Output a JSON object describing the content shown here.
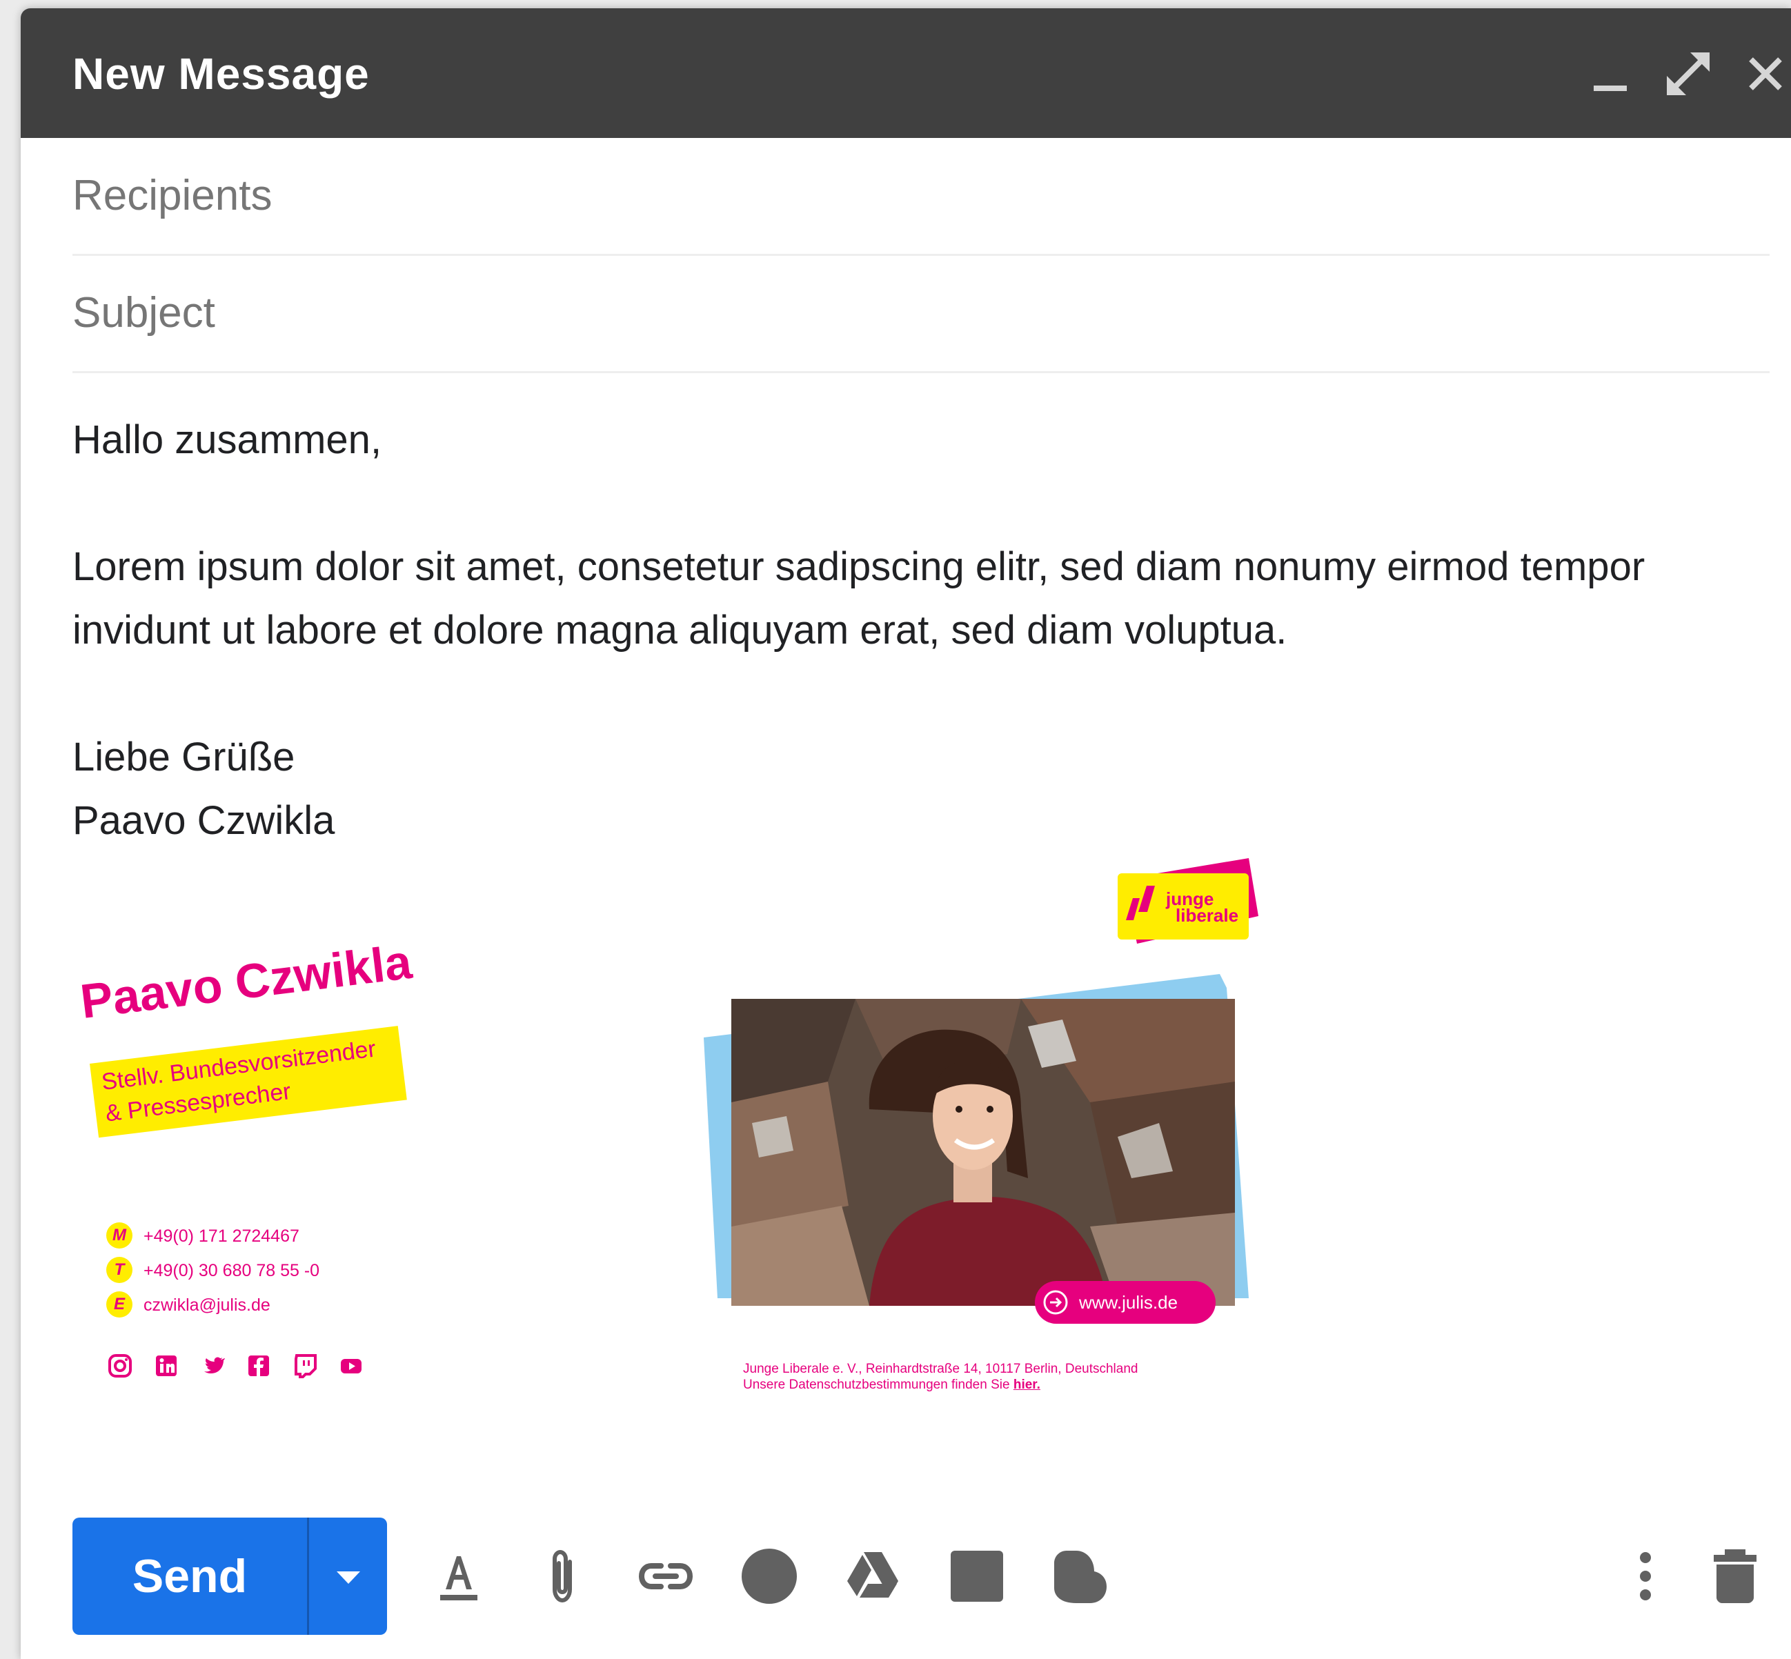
{
  "window": {
    "title": "New Message",
    "minimize_icon": "minimize-icon",
    "expand_icon": "expand-icon",
    "close_icon": "close-icon"
  },
  "fields": {
    "recipients_placeholder": "Recipients",
    "subject_placeholder": "Subject"
  },
  "body": {
    "greeting": "Hallo zusammen,",
    "paragraph_line1": "Lorem ipsum dolor sit amet, consetetur sadipscing elitr, sed diam nonumy eirmod tempor",
    "paragraph_line2": "invidunt ut labore et dolore magna aliquyam erat, sed diam voluptua.",
    "closing": "Liebe Grüße",
    "sender": "Paavo Czwikla"
  },
  "signature": {
    "name": "Paavo Czwikla",
    "role_line1": "Stellv. Bundesvorsitzender",
    "role_line2": "& Pressesprecher",
    "contacts": [
      {
        "badge": "M",
        "value": "+49(0) 171 2724467"
      },
      {
        "badge": "T",
        "value": "+49(0) 30 680 78 55 -0"
      },
      {
        "badge": "E",
        "value": "czwikla@julis.de"
      }
    ],
    "social_icons": [
      "instagram-icon",
      "linkedin-icon",
      "twitter-icon",
      "facebook-icon",
      "twitch-icon",
      "youtube-icon"
    ],
    "logo_line1": "junge",
    "logo_line2": "liberale",
    "website": "www.julis.de",
    "address": "Junge Liberale e. V., Reinhardtstraße 14, 10117 Berlin, Deutschland",
    "privacy_text": "Unsere Datenschutzbestimmungen finden Sie",
    "privacy_link": "hier.",
    "colors": {
      "magenta": "#e6007e",
      "yellow": "#ffed00",
      "sky": "#8ecdf0"
    }
  },
  "toolbar": {
    "send_label": "Send",
    "icons": [
      "send-options-icon",
      "formatting-icon",
      "attach-icon",
      "link-icon",
      "emoji-icon",
      "drive-icon",
      "photo-icon",
      "confidential-icon",
      "more-options-icon",
      "trash-icon"
    ]
  },
  "colors": {
    "titlebar": "#404040",
    "send": "#1a73e8",
    "icon_gray": "#757575"
  }
}
